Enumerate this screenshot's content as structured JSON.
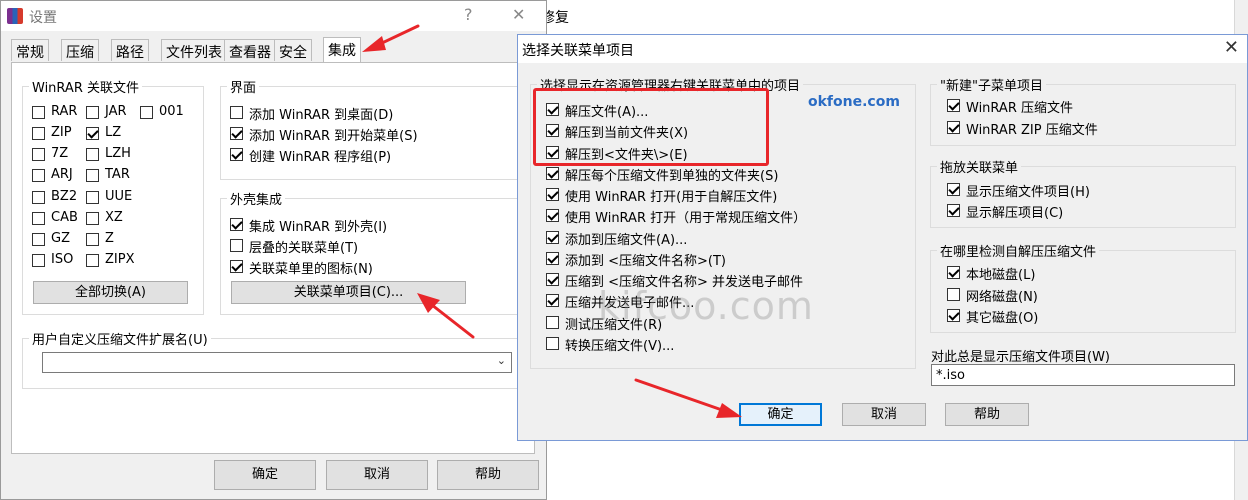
{
  "background": {
    "right_text": "修复"
  },
  "settings": {
    "title": "设置",
    "help_btn": "?",
    "close_btn": "✕",
    "tabs": [
      "常规",
      "压缩",
      "路径",
      "文件列表",
      "查看器",
      "安全",
      "集成"
    ],
    "active_tab": "集成",
    "assoc_group": {
      "title": "WinRAR 关联文件",
      "items": [
        {
          "label": "RAR",
          "checked": false
        },
        {
          "label": "JAR",
          "checked": false
        },
        {
          "label": "001",
          "checked": false
        },
        {
          "label": "ZIP",
          "checked": false
        },
        {
          "label": "LZ",
          "checked": true
        },
        {
          "label": "7Z",
          "checked": false
        },
        {
          "label": "LZH",
          "checked": false
        },
        {
          "label": "ARJ",
          "checked": false
        },
        {
          "label": "TAR",
          "checked": false
        },
        {
          "label": "BZ2",
          "checked": false
        },
        {
          "label": "UUE",
          "checked": false
        },
        {
          "label": "CAB",
          "checked": false
        },
        {
          "label": "XZ",
          "checked": false
        },
        {
          "label": "GZ",
          "checked": false
        },
        {
          "label": "Z",
          "checked": false
        },
        {
          "label": "ISO",
          "checked": false
        },
        {
          "label": "ZIPX",
          "checked": false
        }
      ],
      "toggle_all": "全部切换(A)"
    },
    "interface_group": {
      "title": "界面",
      "items": [
        {
          "label": "添加 WinRAR 到桌面(D)",
          "checked": false
        },
        {
          "label": "添加 WinRAR 到开始菜单(S)",
          "checked": true
        },
        {
          "label": "创建 WinRAR 程序组(P)",
          "checked": true
        }
      ]
    },
    "shell_group": {
      "title": "外壳集成",
      "items": [
        {
          "label": "集成 WinRAR 到外壳(I)",
          "checked": true
        },
        {
          "label": "层叠的关联菜单(T)",
          "checked": false
        },
        {
          "label": "关联菜单里的图标(N)",
          "checked": true
        }
      ],
      "menu_items_btn": "关联菜单项目(C)..."
    },
    "custom_ext": {
      "title": "用户自定义压缩文件扩展名(U)",
      "value": ""
    },
    "buttons": {
      "ok": "确定",
      "cancel": "取消",
      "help": "帮助"
    }
  },
  "context_dialog": {
    "title": "选择关联菜单项目",
    "close_btn": "✕",
    "explorer_group": {
      "title": "选择显示在资源管理器右键关联菜单中的项目",
      "items": [
        {
          "label": "解压文件(A)...",
          "checked": true
        },
        {
          "label": "解压到当前文件夹(X)",
          "checked": true
        },
        {
          "label": "解压到<文件夹\\>(E)",
          "checked": true
        },
        {
          "label": "解压每个压缩文件到单独的文件夹(S)",
          "checked": true
        },
        {
          "label": "使用 WinRAR 打开(用于自解压文件)",
          "checked": true
        },
        {
          "label": "使用 WinRAR 打开（用于常规压缩文件）",
          "checked": true
        },
        {
          "label": "添加到压缩文件(A)...",
          "checked": true
        },
        {
          "label": "添加到 <压缩文件名称>(T)",
          "checked": true
        },
        {
          "label": "压缩到 <压缩文件名称> 并发送电子邮件",
          "checked": true
        },
        {
          "label": "压缩并发送电子邮件...",
          "checked": true
        },
        {
          "label": "测试压缩文件(R)",
          "checked": false
        },
        {
          "label": "转换压缩文件(V)...",
          "checked": false
        }
      ]
    },
    "new_submenu_group": {
      "title": "\"新建\"子菜单项目",
      "items": [
        {
          "label": "WinRAR 压缩文件",
          "checked": true
        },
        {
          "label": "WinRAR ZIP 压缩文件",
          "checked": true
        }
      ]
    },
    "drag_group": {
      "title": "拖放关联菜单",
      "items": [
        {
          "label": "显示压缩文件项目(H)",
          "checked": true
        },
        {
          "label": "显示解压项目(C)",
          "checked": true
        }
      ]
    },
    "detect_group": {
      "title": "在哪里检测自解压压缩文件",
      "items": [
        {
          "label": "本地磁盘(L)",
          "checked": true
        },
        {
          "label": "网络磁盘(N)",
          "checked": false
        },
        {
          "label": "其它磁盘(O)",
          "checked": true
        }
      ]
    },
    "always_show": {
      "title": "对此总是显示压缩文件项目(W)",
      "value": "*.iso"
    },
    "buttons": {
      "ok": "确定",
      "cancel": "取消",
      "help": "帮助"
    }
  },
  "watermarks": {
    "small": "okfone.com",
    "large": "kifcoo.com"
  },
  "colors": {
    "highlight": "#e8262a",
    "accent": "#0078d7",
    "watermark": "#2b6cc4"
  }
}
